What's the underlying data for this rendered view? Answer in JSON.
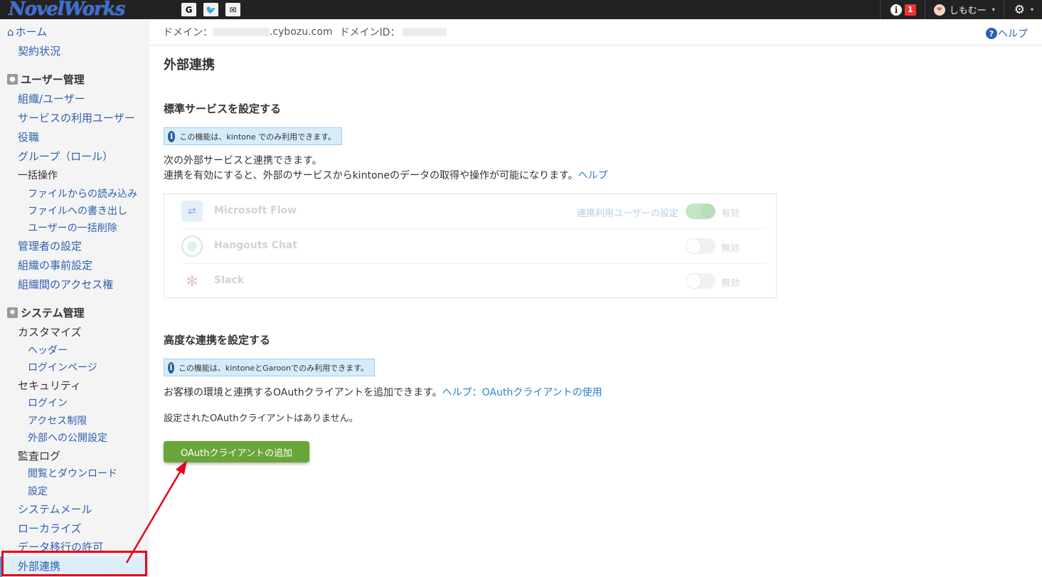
{
  "topbar": {
    "logo": "NovelWorks",
    "apps": [
      "G",
      "🐦",
      "✉"
    ],
    "notification_count": "1",
    "user_name": "しもむー",
    "caret": "▾"
  },
  "header": {
    "domain_label": "ドメイン：",
    "domain_suffix": ".cybozu.com",
    "domain_id_label": "ドメインID：",
    "help": "ヘルプ"
  },
  "sidebar": {
    "home": "ホーム",
    "contract": "契約状況",
    "user_admin_header": "ユーザー管理",
    "org_users": "組織/ユーザー",
    "service_users": "サービスの利用ユーザー",
    "roles": "役職",
    "groups": "グループ（ロール）",
    "bulk_ops": "一括操作",
    "import_file": "ファイルからの読み込み",
    "export_file": "ファイルへの書き出し",
    "bulk_delete": "ユーザーの一括削除",
    "admin_settings": "管理者の設定",
    "org_presets": "組織の事前設定",
    "org_access": "組織間のアクセス権",
    "system_admin_header": "システム管理",
    "customize": "カスタマイズ",
    "header_item": "ヘッダー",
    "login_page": "ログインページ",
    "security": "セキュリティ",
    "login": "ログイン",
    "access_restriction": "アクセス制限",
    "external_publish": "外部への公開設定",
    "audit_log": "監査ログ",
    "view_download": "閲覧とダウンロード",
    "log_settings": "設定",
    "system_mail": "システムメール",
    "localize": "ローカライズ",
    "data_migration": "データ移行の許可",
    "external_integration": "外部連携"
  },
  "main": {
    "title": "外部連携",
    "standard_title": "標準サービスを設定する",
    "standard_note": "この機能は、kintone でのみ利用できます。",
    "standard_desc1": "次の外部サービスと連携できます。",
    "standard_desc2": "連携を有効にすると、外部のサービスからkintoneのデータの取得や操作が可能になります。",
    "standard_help": "ヘルプ",
    "services": [
      {
        "name": "Microsoft Flow",
        "link": "連携利用ユーザーの設定",
        "state": "有効",
        "on": true
      },
      {
        "name": "Hangouts Chat",
        "link": "",
        "state": "無効",
        "on": false
      },
      {
        "name": "Slack",
        "link": "",
        "state": "無効",
        "on": false
      }
    ],
    "advanced_title": "高度な連携を設定する",
    "advanced_note": "この機能は、kintoneとGaroonでのみ利用できます。",
    "advanced_desc": "お客様の環境と連携するOAuthクライアントを追加できます。",
    "advanced_help": "ヘルプ：OAuthクライアントの使用",
    "no_clients": "設定されたOAuthクライアントはありません。",
    "add_button": "OAuthクライアントの追加"
  },
  "colors": {
    "topbar": "#222222",
    "link": "#2f5fb0",
    "button": "#6aa53a",
    "annotation": "#e8001c"
  }
}
